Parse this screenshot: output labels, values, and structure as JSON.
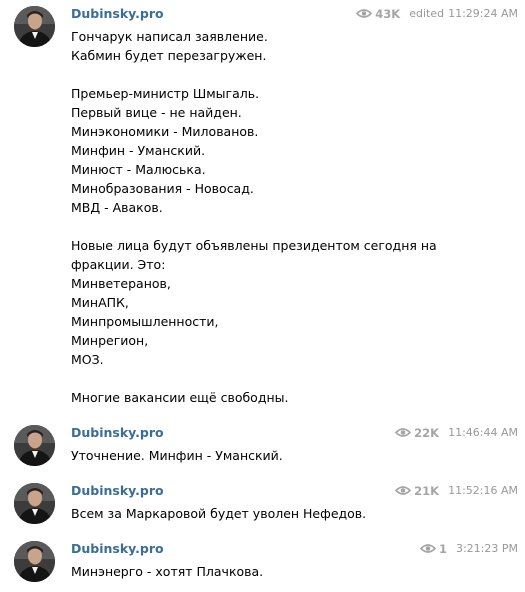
{
  "messages": [
    {
      "author": "Dubinsky.pro",
      "views": "43K",
      "edited": "edited",
      "time": "11:29:24 AM",
      "lines": [
        "Гончарук написал заявление.",
        "Кабмин будет перезагружен.",
        "",
        "Премьер-министр Шмыгаль.",
        "Первый вице - не найден.",
        "Минэкономики - Милованов.",
        "Минфин - Уманский.",
        "Минюст - Малюська.",
        "Минобразования - Новосад.",
        "МВД - Аваков.",
        "",
        "Новые лица будут объявлены президентом сегодня на",
        "фракции. Это:",
        "Минветеранов,",
        "МинАПК,",
        "Минпромышленности,",
        "Минрегион,",
        "МОЗ.",
        "",
        "Многие вакансии ещё свободны."
      ]
    },
    {
      "author": "Dubinsky.pro",
      "views": "22K",
      "time": "11:46:44 AM",
      "lines": [
        "Уточнение. Минфин - Уманский."
      ]
    },
    {
      "author": "Dubinsky.pro",
      "views": "21K",
      "time": "11:52:16 AM",
      "lines": [
        "Всем за Маркаровой будет уволен Нефедов."
      ]
    },
    {
      "author": "Dubinsky.pro",
      "views": "1",
      "time": "3:21:23 PM",
      "lines": [
        "Минэнерго - хотят Плачкова."
      ]
    }
  ],
  "colors": {
    "author": "#3a6d99",
    "meta": "#999999",
    "text": "#000000"
  },
  "icons": {
    "views": "eye-icon",
    "avatar": "person-photo"
  }
}
